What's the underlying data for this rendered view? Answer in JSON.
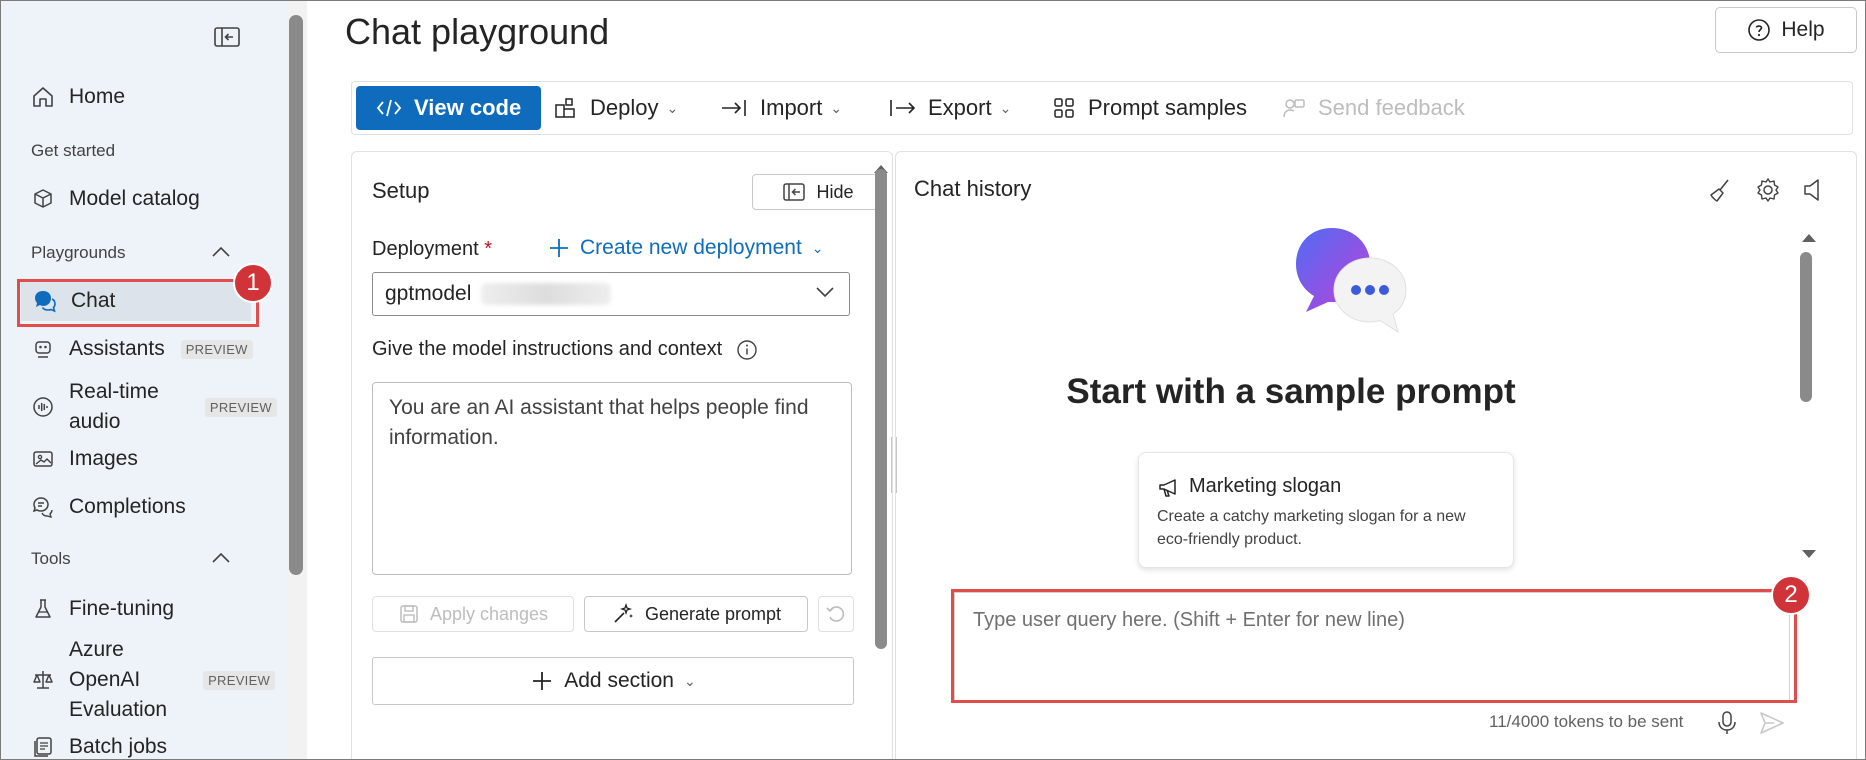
{
  "sidebar": {
    "home": "Home",
    "get_started": "Get started",
    "model_catalog": "Model catalog",
    "playgrounds": "Playgrounds",
    "chat": "Chat",
    "assistants": "Assistants",
    "realtime_line1": "Real-time",
    "realtime_line2": "audio",
    "images": "Images",
    "completions": "Completions",
    "tools": "Tools",
    "fine_tuning": "Fine-tuning",
    "azure_eval_line1": "Azure",
    "azure_eval_line2": "OpenAI",
    "azure_eval_line3": "Evaluation",
    "batch_jobs": "Batch jobs",
    "preview_badge": "PREVIEW"
  },
  "header": {
    "title": "Chat playground",
    "help": "Help"
  },
  "toolbar": {
    "view_code": "View code",
    "deploy": "Deploy",
    "import": "Import",
    "export": "Export",
    "prompt_samples": "Prompt samples",
    "send_feedback": "Send feedback"
  },
  "setup": {
    "title": "Setup",
    "hide": "Hide",
    "deployment_label": "Deployment",
    "required_mark": "*",
    "create_deployment": "Create new deployment",
    "deployment_value": "gptmodel",
    "instructions_label": "Give the model instructions and context",
    "instructions_text": "You are an AI assistant that helps people find information.",
    "apply_changes": "Apply changes",
    "generate_prompt": "Generate prompt",
    "add_section": "Add section"
  },
  "chat": {
    "title": "Chat history",
    "heading": "Start with a sample prompt",
    "card_title": "Marketing slogan",
    "card_desc": "Create a catchy marketing slogan for a new eco-friendly product.",
    "query_placeholder": "Type user query here. (Shift + Enter for new line)",
    "tokens": "11/4000 tokens to be sent"
  },
  "annotations": {
    "badge1": "1",
    "badge2": "2"
  },
  "colors": {
    "accent": "#0f6cbd",
    "highlight_red": "#e14c4c",
    "badge_red": "#d13438",
    "sidebar_bg": "#eef3f9"
  }
}
